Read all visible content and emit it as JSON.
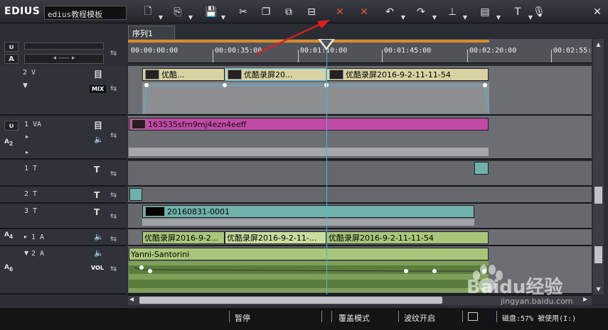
{
  "app": {
    "brand": "EDIUS",
    "project_name": "edius教程模板"
  },
  "toolbar": {
    "icons": [
      "new-file-icon",
      "open-folder-icon",
      "save-icon",
      "cut-icon",
      "copy-icon",
      "paste-icon",
      "link-icon",
      "delete-gap-icon",
      "delete-icon",
      "undo-icon",
      "redo-icon",
      "marker-icon",
      "render-icon",
      "text-icon",
      "mic-icon",
      "close-icon"
    ]
  },
  "sequence": {
    "tab_label": "序列1"
  },
  "ruler": {
    "timecodes": [
      "00:00:00:00",
      "00:00:35:00",
      "00:01:10:00",
      "00:01:45:00",
      "00:02:20:00",
      "00:02:55:"
    ]
  },
  "tracks": {
    "v2": {
      "name": "2 V",
      "mix_label": "MIX"
    },
    "va1": {
      "name": "1 VA"
    },
    "t1": {
      "name": "1 T"
    },
    "t2": {
      "name": "2 T"
    },
    "t3": {
      "name": "3 T"
    },
    "a1": {
      "name": "1 A"
    },
    "a2": {
      "name": "2 A",
      "vol_label": "VOL"
    },
    "a_labels": {
      "a12": "A1\n2",
      "a34": "A3\n4",
      "a56": "A5\n6"
    }
  },
  "clips": {
    "v2": [
      "优酷...",
      "优酷录屏20...",
      "优酷录屏2016-9-2-11-11-54"
    ],
    "va1": [
      "163535sfrn9mj4ezn4eeff"
    ],
    "t3": [
      "20160831-0001"
    ],
    "a1": [
      "优酷录屏2016-9-2...",
      "优酷录屏2016-9-2-11-...",
      "优酷录屏2016-9-2-11-11-54"
    ],
    "a2": [
      "Yanni-Santorini"
    ]
  },
  "status": {
    "pause": "暂停",
    "overwrite_mode": "覆盖模式",
    "ripple": "波纹开启",
    "disk": "磁盘:57% 被使用(I:)"
  },
  "watermark": {
    "brand": "Baidu经验",
    "url": "jingyan.baidu.com"
  },
  "colors": {
    "va_clip": "#c14aa6",
    "title_clip": "#6fb2ac",
    "video_clip": "#d9d3a3",
    "audio_clip": "#a8c77a",
    "playhead": "#4fb3d9",
    "arrow": "#e01f1f"
  }
}
